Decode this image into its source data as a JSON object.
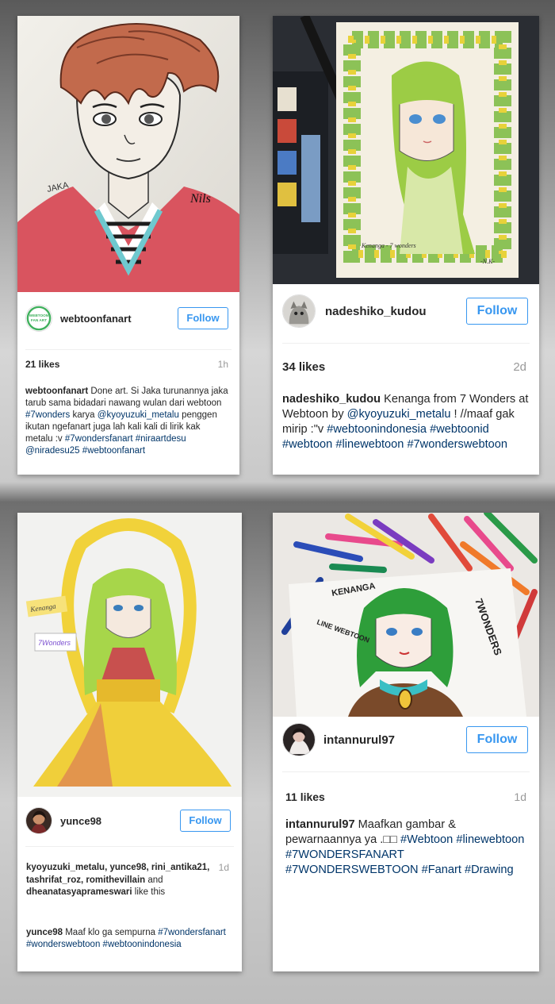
{
  "posts": [
    {
      "photo": "jaka-sketch-boy-red-hoodie",
      "avatar": "webtoonfanart-logo",
      "avatar_text": "WEBTOON FAN ART",
      "username": "webtoonfanart",
      "follow_label": "Follow",
      "likes": "21 likes",
      "time": "1h",
      "caption": {
        "user": "webtoonfanart",
        "text1": " Done art. Si Jaka turunannya jaka tarub sama bidadari nawang wulan dari webtoon ",
        "tag1": "#7wonders",
        "text2": " karya ",
        "mention1": "@kyoyuzuki_metalu",
        "text3": " penggen ikutan ngefanart juga lah kali kali di lirik kak metalu :v ",
        "tag2": "#7wondersfanart",
        "tag3": "#niraartdesu",
        "mention2": "@niradesu25",
        "tag4": "#webtoonfanart"
      }
    },
    {
      "photo": "kenanga-watercolor-green-hair",
      "avatar": "gray-cat-avatar",
      "username": "nadeshiko_kudou",
      "follow_label": "Follow",
      "likes": "34 likes",
      "time": "2d",
      "caption": {
        "user": "nadeshiko_kudou",
        "text1": " Kenanga from 7 Wonders at Webtoon by ",
        "mention1": "@kyoyuzuki_metalu",
        "text2": " ! //maaf gak mirip :\"v ",
        "tag1": "#webtoonindonesia",
        "tag2": "#webtoonid",
        "tag3": "#webtoon",
        "tag4": "#linewebtoon",
        "tag5": "#7wonderswebtoon"
      }
    },
    {
      "photo": "kenanga-yellow-dress-drawing",
      "avatar": "yunce98-avatar",
      "username": "yunce98",
      "follow_label": "Follow",
      "time": "1d",
      "likers": {
        "names": "kyoyuzuki_metalu, yunce98, rini_antika21, tashrifat_roz, romithevillain",
        "and": " and ",
        "last": "dheanatasyaprameswari",
        "suffix": " like this"
      },
      "caption": {
        "user": "yunce98",
        "text1": " Maaf klo ga sempurna ",
        "tag1": "#7wondersfanart",
        "tag2": "#wonderswebtoon",
        "tag3": "#webtoonindonesia"
      }
    },
    {
      "photo": "kenanga-marker-drawing-with-pens",
      "avatar": "intannurul97-avatar",
      "username": "intannurul97",
      "follow_label": "Follow",
      "likes": "11 likes",
      "time": "1d",
      "caption": {
        "user": "intannurul97",
        "text1": " Maafkan gambar & pewarnaannya ya .□□ ",
        "tag1": "#Webtoon",
        "tag2": "#linewebtoon",
        "tag3": "#7WONDERSFANART",
        "tag4": "#7WONDERSWEBTOON",
        "tag5": "#Fanart",
        "tag6": "#Drawing"
      }
    }
  ],
  "photo_labels": {
    "p1_name": "JAKA",
    "p1_sign": "Nils",
    "p2_name": "Kenanga - 7 wonders",
    "p2_sign": "-N.K-",
    "p3_label1": "Kenanga",
    "p3_label2": "7Wonders",
    "p4_label1": "KENANGA",
    "p4_label2": "LINE WEBTOON",
    "p4_label3": "7WONDERS"
  },
  "colors": {
    "follow_blue": "#3897f0",
    "hashtag": "#003569",
    "text": "#262626",
    "muted": "#999999"
  }
}
